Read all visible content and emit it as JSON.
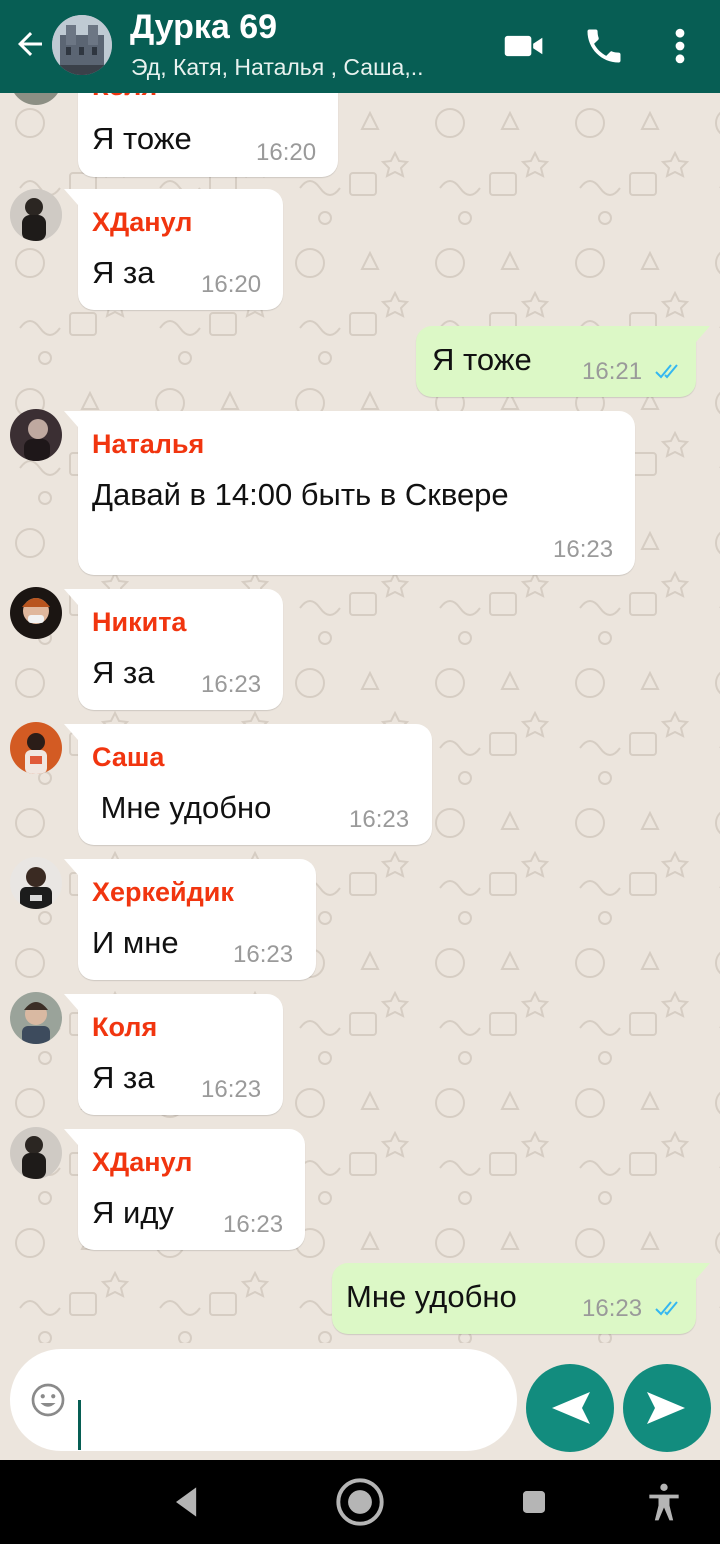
{
  "header": {
    "title": "Дурка 69",
    "subtitle": "Эд, Катя, Наталья , Саша,.."
  },
  "messages": [
    {
      "sender": "Коля",
      "text": "Я тоже",
      "time": "16:20"
    },
    {
      "sender": "ХДанул",
      "text": "Я за",
      "time": "16:20"
    },
    {
      "text": "Я тоже",
      "time": "16:21"
    },
    {
      "sender": "Наталья",
      "text": "Давай в 14:00 быть в Сквере",
      "time": "16:23"
    },
    {
      "sender": "Никита",
      "text": "Я за",
      "time": "16:23"
    },
    {
      "sender": "Саша",
      "text": " Мне удобно",
      "time": "16:23"
    },
    {
      "sender": "Херкейдик",
      "text": "И мне",
      "time": "16:23"
    },
    {
      "sender": "Коля",
      "text": "Я за",
      "time": "16:23"
    },
    {
      "sender": "ХДанул",
      "text": "Я иду",
      "time": "16:23"
    },
    {
      "text": "Мне удобно",
      "time": "16:23"
    }
  ],
  "input": {
    "value": ""
  },
  "colors": {
    "header": "#075e54",
    "accent": "#128c7e",
    "sender_name": "#f1350f",
    "outgoing_bubble": "#dcf8c6",
    "read_ticks": "#34b7f1"
  },
  "icons": [
    "back-arrow-icon",
    "video-call-icon",
    "phone-icon",
    "more-vert-icon",
    "emoji-icon",
    "left-send-icon",
    "send-icon",
    "nav-back-icon",
    "nav-home-icon",
    "nav-recents-icon",
    "accessibility-icon"
  ]
}
